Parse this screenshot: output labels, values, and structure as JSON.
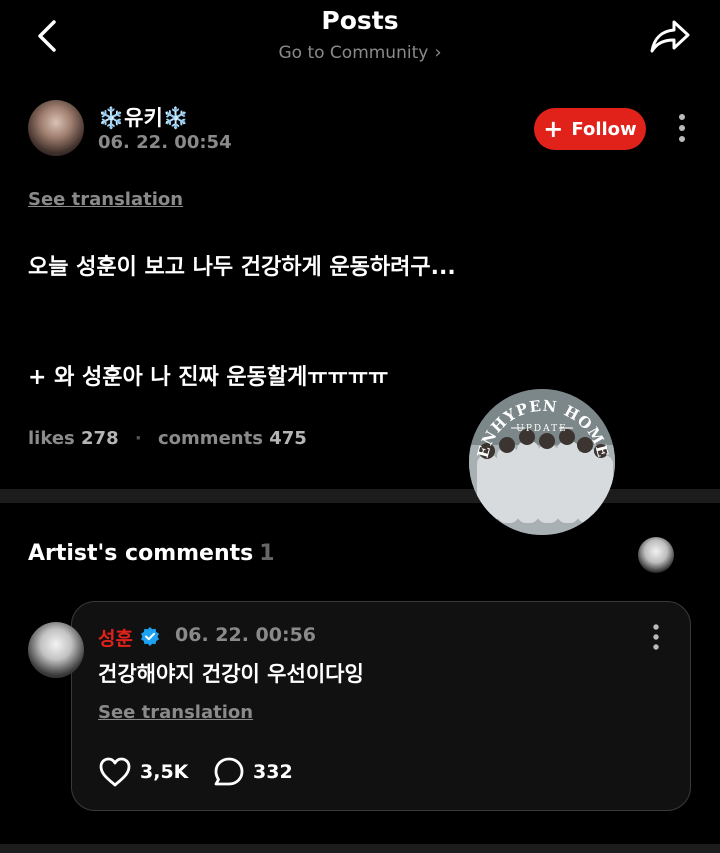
{
  "header": {
    "title": "Posts",
    "subtitle": "Go to Community",
    "subtitle_chevron": "›"
  },
  "post": {
    "author_name": "❄️유키❄️",
    "date": "06. 22. 00:54",
    "follow_label": "Follow",
    "see_translation": "See translation",
    "body_line1": "오늘 성훈이 보고 나두 건강하게 운동하려구...",
    "body_line2": "+ 와 성훈아 나 진짜 운동할게ㅠㅠㅠㅠ",
    "likes_label": "likes",
    "likes_count": "278",
    "comments_label": "comments",
    "comments_count": "475",
    "stat_separator": "·"
  },
  "watermark": {
    "line1": "ENHYPEN HOME",
    "line2": "UPDATE"
  },
  "artist_comments": {
    "title": "Artist's comments",
    "count": "1"
  },
  "comment": {
    "author_name": "성훈",
    "date": "06. 22. 00:56",
    "text": "건강해야지 건강이 우선이다잉",
    "see_translation": "See translation",
    "likes": "3,5K",
    "replies": "332"
  },
  "icons": {
    "back": "chevron-left-icon",
    "share": "share-arrow-icon",
    "more": "vertical-dots-icon",
    "verified": "verified-check-icon",
    "like": "heart-icon",
    "reply": "speech-bubble-icon"
  },
  "colors": {
    "background": "#000000",
    "accent": "#e0221b",
    "muted": "#8a8a8a",
    "verified": "#1da1f2"
  }
}
